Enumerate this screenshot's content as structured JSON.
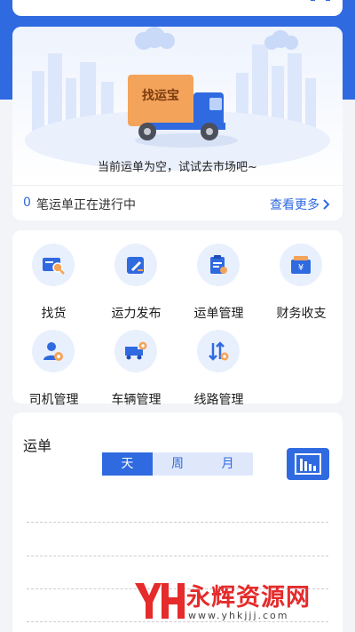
{
  "hero": {
    "truck_brand": "找运宝",
    "empty_message": "当前运单为空，试试去市场吧~",
    "active_count": "0",
    "active_text": "笔运单正在进行中",
    "more_label": "查看更多"
  },
  "menu": {
    "items": [
      {
        "label": "找货",
        "icon": "find-cargo-icon"
      },
      {
        "label": "运力发布",
        "icon": "capacity-publish-icon"
      },
      {
        "label": "运单管理",
        "icon": "waybill-manage-icon"
      },
      {
        "label": "财务收支",
        "icon": "finance-icon"
      },
      {
        "label": "司机管理",
        "icon": "driver-manage-icon"
      },
      {
        "label": "车辆管理",
        "icon": "vehicle-manage-icon"
      },
      {
        "label": "线路管理",
        "icon": "route-manage-icon"
      }
    ]
  },
  "orders": {
    "title": "运单",
    "tabs": [
      "天",
      "周",
      "月"
    ],
    "active_tab": "天"
  },
  "watermark": {
    "name": "永辉资源网",
    "url": "www.yhkjjj.com"
  },
  "colors": {
    "primary": "#2f6ae0",
    "truck_box": "#f4a35a",
    "watermark": "#e52b2b"
  }
}
